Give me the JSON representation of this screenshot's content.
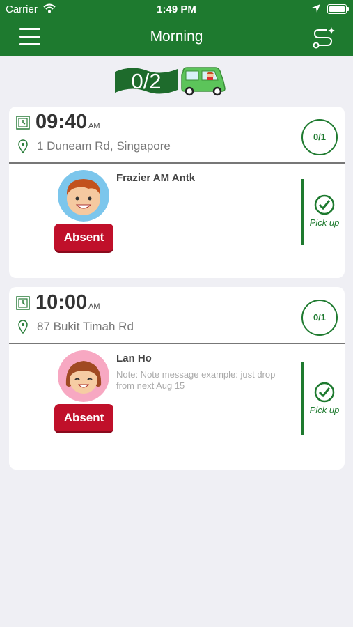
{
  "status_bar": {
    "carrier": "Carrier",
    "time": "1:49 PM"
  },
  "nav": {
    "title": "Morning",
    "left_icon": "hamburger-menu-icon",
    "right_icon": "route-icon"
  },
  "progress": {
    "count": "0/2",
    "icon": "car-icon"
  },
  "stops": [
    {
      "time": "09:40",
      "ampm": "AM",
      "address": "1 Duneam Rd, Singapore",
      "count": "0/1",
      "student": {
        "name": "Frazier AM Antk",
        "note": "",
        "avatar": "boy-avatar",
        "absent_label": "Absent",
        "action_label": "Pick up"
      }
    },
    {
      "time": "10:00",
      "ampm": "AM",
      "address": "87 Bukit Timah Rd",
      "count": "0/1",
      "student": {
        "name": "Lan Ho",
        "note": "Note: Note message example: just drop from next Aug 15",
        "avatar": "girl-avatar",
        "absent_label": "Absent",
        "action_label": "Pick up"
      }
    }
  ],
  "colors": {
    "primary": "#1e7a2f",
    "absent": "#c0102a",
    "background": "#efeff4"
  }
}
